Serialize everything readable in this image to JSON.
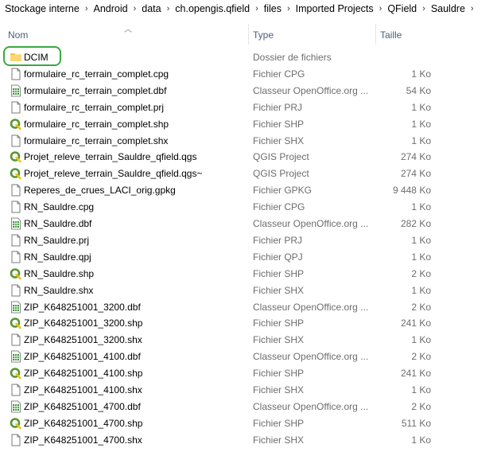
{
  "breadcrumb": [
    "Stockage interne",
    "Android",
    "data",
    "ch.opengis.qfield",
    "files",
    "Imported Projects",
    "QField",
    "Sauldre"
  ],
  "columns": {
    "name": "Nom",
    "type": "Type",
    "size": "Taille"
  },
  "files": [
    {
      "name": "DCIM",
      "type": "Dossier de fichiers",
      "size": "",
      "icon": "folder-icon"
    },
    {
      "name": "formulaire_rc_terrain_complet.cpg",
      "type": "Fichier CPG",
      "size": "1 Ko",
      "icon": "file-icon"
    },
    {
      "name": "formulaire_rc_terrain_complet.dbf",
      "type": "Classeur OpenOffice.org ...",
      "size": "54 Ko",
      "icon": "spreadsheet-icon"
    },
    {
      "name": "formulaire_rc_terrain_complet.prj",
      "type": "Fichier PRJ",
      "size": "1 Ko",
      "icon": "file-icon"
    },
    {
      "name": "formulaire_rc_terrain_complet.shp",
      "type": "Fichier SHP",
      "size": "1 Ko",
      "icon": "qgis-icon"
    },
    {
      "name": "formulaire_rc_terrain_complet.shx",
      "type": "Fichier SHX",
      "size": "1 Ko",
      "icon": "file-icon"
    },
    {
      "name": "Projet_releve_terrain_Sauldre_qfield.qgs",
      "type": "QGIS Project",
      "size": "274 Ko",
      "icon": "qgis-icon"
    },
    {
      "name": "Projet_releve_terrain_Sauldre_qfield.qgs~",
      "type": "QGIS Project",
      "size": "274 Ko",
      "icon": "qgis-icon"
    },
    {
      "name": "Reperes_de_crues_LACI_orig.gpkg",
      "type": "Fichier GPKG",
      "size": "9 448 Ko",
      "icon": "file-icon"
    },
    {
      "name": "RN_Sauldre.cpg",
      "type": "Fichier CPG",
      "size": "1 Ko",
      "icon": "file-icon"
    },
    {
      "name": "RN_Sauldre.dbf",
      "type": "Classeur OpenOffice.org ...",
      "size": "282 Ko",
      "icon": "spreadsheet-icon"
    },
    {
      "name": "RN_Sauldre.prj",
      "type": "Fichier PRJ",
      "size": "1 Ko",
      "icon": "file-icon"
    },
    {
      "name": "RN_Sauldre.qpj",
      "type": "Fichier QPJ",
      "size": "1 Ko",
      "icon": "file-icon"
    },
    {
      "name": "RN_Sauldre.shp",
      "type": "Fichier SHP",
      "size": "2 Ko",
      "icon": "qgis-icon"
    },
    {
      "name": "RN_Sauldre.shx",
      "type": "Fichier SHX",
      "size": "1 Ko",
      "icon": "file-icon"
    },
    {
      "name": "ZIP_K648251001_3200.dbf",
      "type": "Classeur OpenOffice.org ...",
      "size": "2 Ko",
      "icon": "spreadsheet-icon"
    },
    {
      "name": "ZIP_K648251001_3200.shp",
      "type": "Fichier SHP",
      "size": "241 Ko",
      "icon": "qgis-icon"
    },
    {
      "name": "ZIP_K648251001_3200.shx",
      "type": "Fichier SHX",
      "size": "1 Ko",
      "icon": "file-icon"
    },
    {
      "name": "ZIP_K648251001_4100.dbf",
      "type": "Classeur OpenOffice.org ...",
      "size": "2 Ko",
      "icon": "spreadsheet-icon"
    },
    {
      "name": "ZIP_K648251001_4100.shp",
      "type": "Fichier SHP",
      "size": "241 Ko",
      "icon": "qgis-icon"
    },
    {
      "name": "ZIP_K648251001_4100.shx",
      "type": "Fichier SHX",
      "size": "1 Ko",
      "icon": "file-icon"
    },
    {
      "name": "ZIP_K648251001_4700.dbf",
      "type": "Classeur OpenOffice.org ...",
      "size": "2 Ko",
      "icon": "spreadsheet-icon"
    },
    {
      "name": "ZIP_K648251001_4700.shp",
      "type": "Fichier SHP",
      "size": "511 Ko",
      "icon": "qgis-icon"
    },
    {
      "name": "ZIP_K648251001_4700.shx",
      "type": "Fichier SHX",
      "size": "1 Ko",
      "icon": "file-icon"
    }
  ],
  "colors": {
    "highlight": "#3aa843",
    "folder": "#f4c542",
    "qgis": "#589632",
    "spreadsheet": "#3b9c3b"
  }
}
